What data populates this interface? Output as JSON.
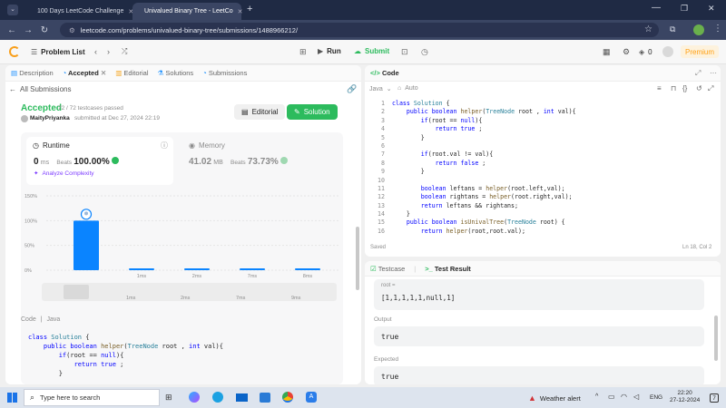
{
  "browser": {
    "tabs": [
      {
        "title": "100 Days LeetCode Challenge"
      },
      {
        "title": "Univalued Binary Tree - LeetCo"
      }
    ],
    "url": "leetcode.com/problems/univalued-binary-tree/submissions/1488966212/"
  },
  "header": {
    "problem_list": "Problem List",
    "run": "Run",
    "submit": "Submit",
    "streak": "0",
    "premium": "Premium"
  },
  "left": {
    "tabs": [
      "Description",
      "Accepted",
      "Editorial",
      "Solutions",
      "Submissions"
    ],
    "all_submissions": "All Submissions",
    "status": "Accepted",
    "testcases": "72 / 72 testcases passed",
    "user": "MaityPriyanka",
    "submitted": "submitted at Dec 27, 2024 22:19",
    "editorial_btn": "Editorial",
    "solution_btn": "Solution",
    "runtime_label": "Runtime",
    "runtime_value": "0",
    "runtime_unit": "ms",
    "beats_label": "Beats",
    "beats_value": "100.00%",
    "analyze": "Analyze Complexity",
    "memory_label": "Memory",
    "memory_value": "41.02",
    "memory_unit": "MB",
    "memory_beats_label": "Beats",
    "memory_beats_value": "73.73%",
    "code_label": "Code",
    "lang": "Java",
    "code_lines": [
      "class Solution {",
      "    public boolean helper(TreeNode root , int val){",
      "        if(root == null){",
      "            return true ;",
      "        }"
    ]
  },
  "chart_data": {
    "type": "bar",
    "categories": [
      "",
      "1ms",
      "2ms",
      "7ms",
      "8ms"
    ],
    "values": [
      100,
      3,
      3,
      3,
      3
    ],
    "ylim": [
      0,
      150
    ],
    "y_ticks": [
      "150%",
      "100%",
      "50%",
      "0%"
    ],
    "mini_labels": [
      "1ms",
      "2ms",
      "7ms",
      "9ms"
    ],
    "colors": {
      "bar": "#0a84ff"
    }
  },
  "code": {
    "title": "Code",
    "lang": "Java",
    "auto": "Auto",
    "saved": "Saved",
    "cursor": "Ln 18, Col 2",
    "line_numbers": [
      "1",
      "2",
      "3",
      "4",
      "5",
      "6",
      "7",
      "8",
      "9",
      "10",
      "11",
      "12",
      "13",
      "14",
      "15",
      "16"
    ],
    "lines": [
      "class Solution {",
      "    public boolean helper(TreeNode root , int val){",
      "        if(root == null){",
      "            return true ;",
      "        }",
      "",
      "        if(root.val != val){",
      "            return false ;",
      "        }",
      "",
      "        boolean leftans = helper(root.left,val);",
      "        boolean rightans = helper(root.right,val);",
      "        return leftans && rightans;",
      "    }",
      "    public boolean isUnivalTree(TreeNode root) {",
      "        return helper(root,root.val);"
    ]
  },
  "test": {
    "testcase_tab": "Testcase",
    "result_tab": "Test Result",
    "root_label": "root =",
    "root_value": "[1,1,1,1,1,null,1]",
    "output_label": "Output",
    "output_value": "true",
    "expected_label": "Expected",
    "expected_value": "true"
  },
  "taskbar": {
    "search_placeholder": "Type here to search",
    "weather": "Weather alert",
    "lang": "ENG",
    "time": "22:20",
    "date": "27-12-2024",
    "notif": "7"
  }
}
